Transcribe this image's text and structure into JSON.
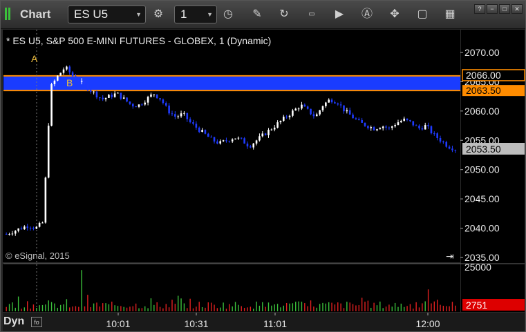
{
  "app": {
    "title": "Chart"
  },
  "toolbar": {
    "symbol": "ES U5",
    "interval": "1"
  },
  "window_buttons": [
    "?",
    "−",
    "□",
    "✕"
  ],
  "chart_data": {
    "type": "candlestick",
    "title": "* ES U5, S&P 500 E-MINI FUTURES - GLOBEX, 1 (Dynamic)",
    "watermark": "© eSignal, 2015",
    "ylim": [
      2035,
      2072
    ],
    "y_ticks": [
      "2070.00",
      "2065.00",
      "2060.00",
      "2055.00",
      "2050.00",
      "2045.00",
      "2040.00",
      "2035.00"
    ],
    "x_ticks": [
      "10:01",
      "10:31",
      "11:01",
      "12:00"
    ],
    "zone": {
      "high": 2066.0,
      "low": 2063.5,
      "high_label": "2066.00",
      "low_label": "2063.50",
      "color": "#1a3cff",
      "border": "#ff8c00"
    },
    "annotations": [
      {
        "text": "A"
      },
      {
        "text": "B"
      }
    ],
    "last_price": "2053.50",
    "price_path": [
      2039.0,
      2039.5,
      2040.0,
      2040.5,
      2040.0,
      2041.0,
      2064.0,
      2066.0,
      2067.5,
      2066.0,
      2065.0,
      2064.0,
      2063.0,
      2062.0,
      2062.5,
      2063.0,
      2062.0,
      2061.0,
      2061.0,
      2062.0,
      2063.0,
      2062.0,
      2060.0,
      2059.0,
      2059.5,
      2058.0,
      2057.0,
      2056.0,
      2055.0,
      2054.5,
      2055.0,
      2055.5,
      2055.0,
      2054.0,
      2055.0,
      2056.0,
      2057.0,
      2058.0,
      2059.0,
      2060.0,
      2061.0,
      2060.0,
      2059.0,
      2061.0,
      2062.0,
      2061.5,
      2060.0,
      2059.0,
      2058.0,
      2057.5,
      2057.0,
      2057.5,
      2057.0,
      2058.0,
      2058.5,
      2058.0,
      2057.0,
      2057.5,
      2056.0,
      2055.0,
      2054.0,
      2053.5
    ],
    "volume": {
      "ylim": [
        0,
        25000
      ],
      "tick": "25000",
      "last_label": "2751"
    }
  },
  "colors": {
    "up": "#ffffff",
    "down": "#1f3bff",
    "vol_up": "#3bbf3b",
    "vol_down": "#e02020"
  },
  "footer": {
    "label": "Dyn"
  }
}
